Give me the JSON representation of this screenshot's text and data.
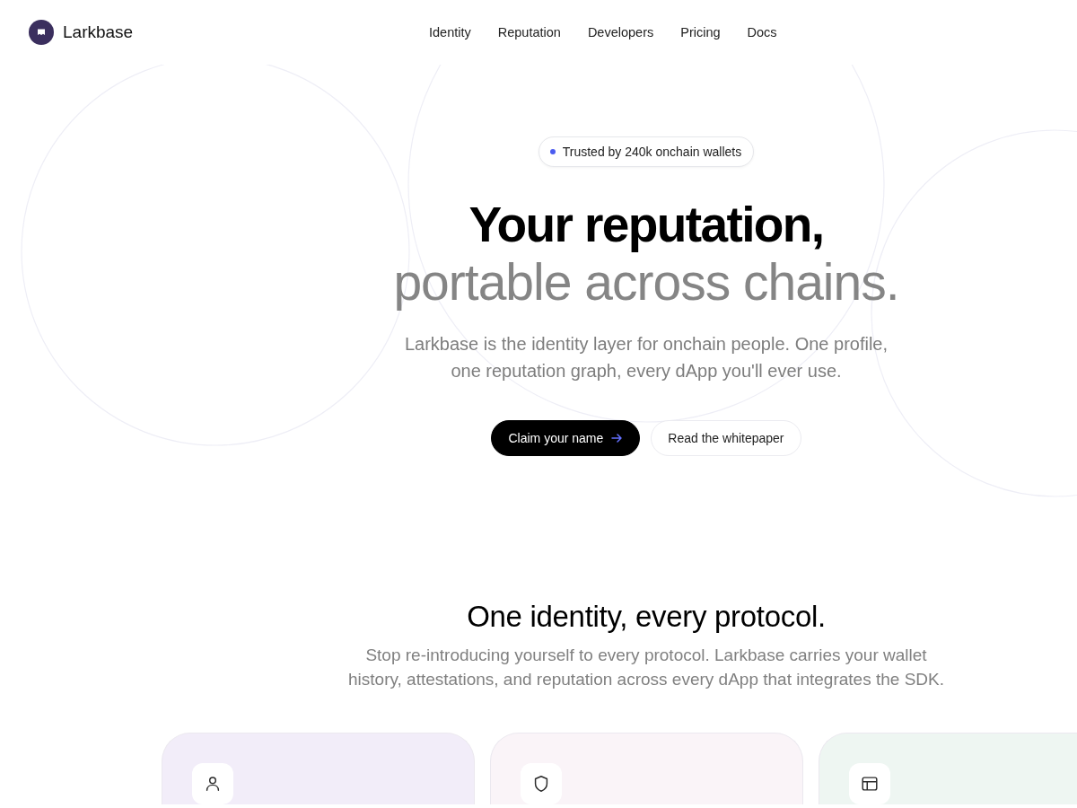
{
  "header": {
    "brand": "Larkbase",
    "nav": [
      {
        "label": "Identity"
      },
      {
        "label": "Reputation"
      },
      {
        "label": "Developers"
      },
      {
        "label": "Pricing"
      },
      {
        "label": "Docs"
      }
    ]
  },
  "hero": {
    "badge": "Trusted by 240k onchain wallets",
    "headline": {
      "line_1": "Your reputation,",
      "line_2": "portable across chains."
    },
    "subtitle": "Larkbase is the identity layer for onchain people. One profile, one reputation graph, every dApp you'll ever use.",
    "buttons": [
      {
        "label": "Claim your name",
        "kind": "primary"
      },
      {
        "label": "Read the whitepaper",
        "kind": "secondary"
      }
    ]
  },
  "features": {
    "title": "One identity, every protocol.",
    "subtitle": "Stop re-introducing yourself to every protocol. Larkbase carries your wallet history, attestations, and reputation across every dApp that integrates the SDK.",
    "cards": [
      {
        "color": "#f2edf9"
      },
      {
        "color": "#faf4f8"
      },
      {
        "color": "#eef6f2"
      }
    ]
  }
}
